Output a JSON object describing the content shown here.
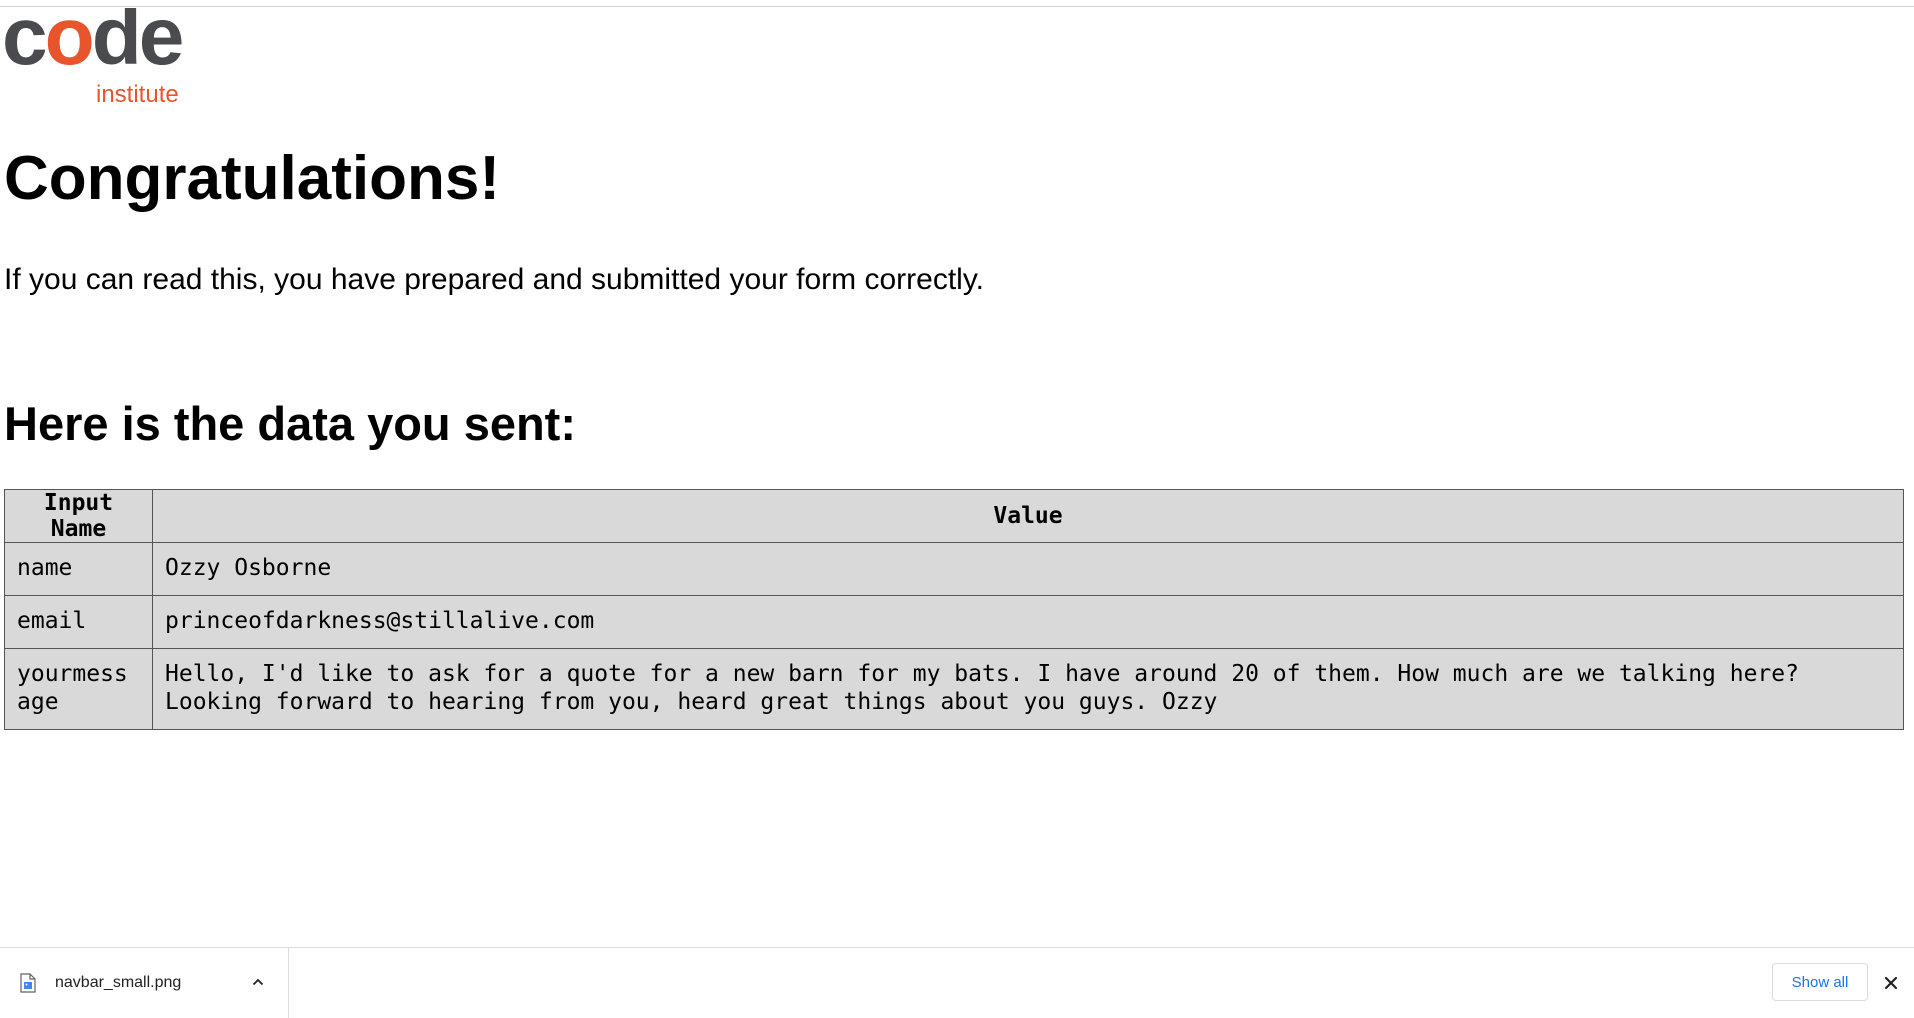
{
  "logo": {
    "code_pre": "c",
    "code_o": "o",
    "code_post": "de",
    "institute": "institute",
    "colors": {
      "grey": "#4a4b4f",
      "orange": "#e8542b"
    }
  },
  "heading": "Congratulations!",
  "lead": "If you can read this, you have prepared and submitted your form correctly.",
  "subheading": "Here is the data you sent:",
  "table": {
    "headers": [
      "Input Name",
      "Value"
    ],
    "rows": [
      {
        "name": "name",
        "value": "Ozzy Osborne"
      },
      {
        "name": "email",
        "value": "princeofdarkness@stillalive.com"
      },
      {
        "name": "yourmessage",
        "value": "Hello, I'd like to ask for a quote for a new barn for my bats. I have around 20 of them. How much are we talking here? Looking forward to hearing from you, heard great things about you guys. Ozzy"
      }
    ]
  },
  "download_bar": {
    "file_name": "navbar_small.png",
    "file_icon": "image-file-icon",
    "show_all_label": "Show all",
    "close_icon": "close-icon",
    "chevron_icon": "chevron-up-icon",
    "accent": "#1a73e8"
  }
}
